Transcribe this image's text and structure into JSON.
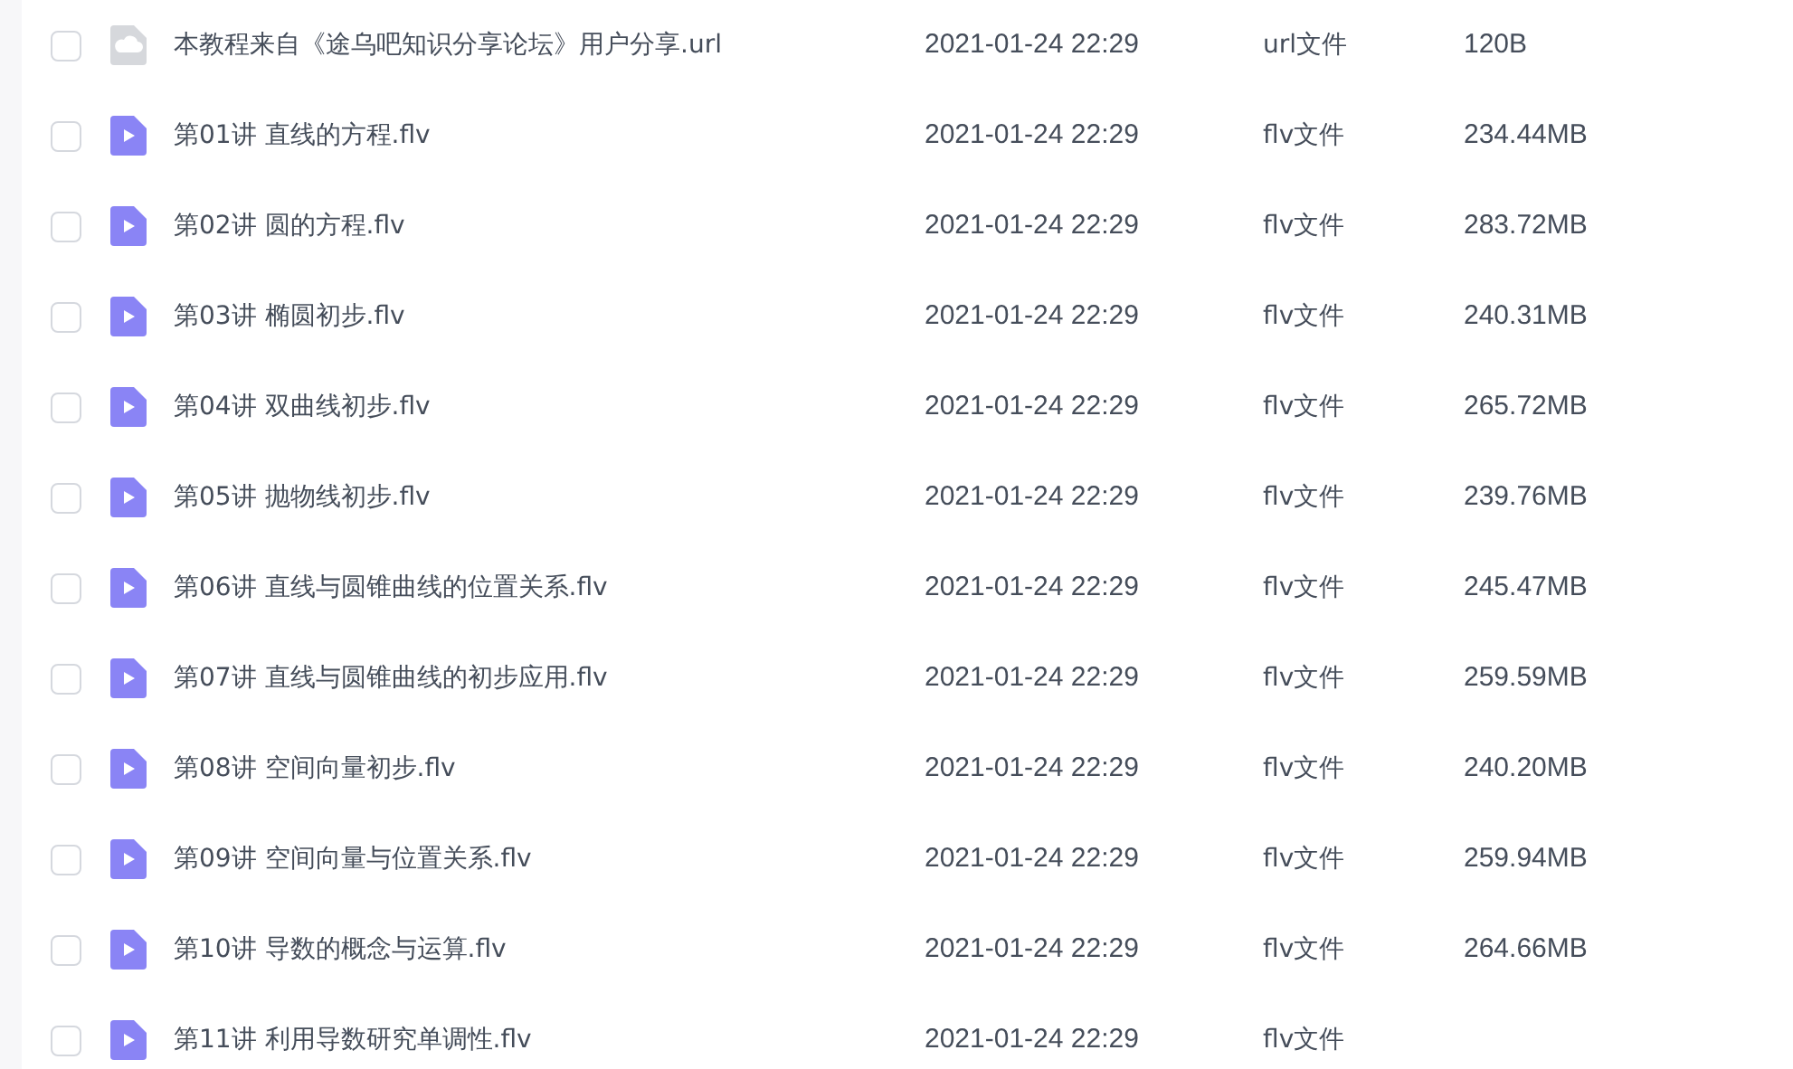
{
  "files": [
    {
      "kind": "link",
      "checked": false,
      "name": "本教程来自《途乌吧知识分享论坛》用户分享.url",
      "time": "2021-01-24 22:29",
      "type": "url文件",
      "size": "120B"
    },
    {
      "kind": "video",
      "checked": false,
      "name": "第01讲 直线的方程.flv",
      "time": "2021-01-24 22:29",
      "type": "flv文件",
      "size": "234.44MB"
    },
    {
      "kind": "video",
      "checked": false,
      "name": "第02讲 圆的方程.flv",
      "time": "2021-01-24 22:29",
      "type": "flv文件",
      "size": "283.72MB"
    },
    {
      "kind": "video",
      "checked": false,
      "name": "第03讲 椭圆初步.flv",
      "time": "2021-01-24 22:29",
      "type": "flv文件",
      "size": "240.31MB"
    },
    {
      "kind": "video",
      "checked": false,
      "name": "第04讲 双曲线初步.flv",
      "time": "2021-01-24 22:29",
      "type": "flv文件",
      "size": "265.72MB"
    },
    {
      "kind": "video",
      "checked": false,
      "name": "第05讲 抛物线初步.flv",
      "time": "2021-01-24 22:29",
      "type": "flv文件",
      "size": "239.76MB"
    },
    {
      "kind": "video",
      "checked": false,
      "name": "第06讲 直线与圆锥曲线的位置关系.flv",
      "time": "2021-01-24 22:29",
      "type": "flv文件",
      "size": "245.47MB"
    },
    {
      "kind": "video",
      "checked": false,
      "name": "第07讲 直线与圆锥曲线的初步应用.flv",
      "time": "2021-01-24 22:29",
      "type": "flv文件",
      "size": "259.59MB"
    },
    {
      "kind": "video",
      "checked": false,
      "name": "第08讲 空间向量初步.flv",
      "time": "2021-01-24 22:29",
      "type": "flv文件",
      "size": "240.20MB"
    },
    {
      "kind": "video",
      "checked": false,
      "name": "第09讲 空间向量与位置关系.flv",
      "time": "2021-01-24 22:29",
      "type": "flv文件",
      "size": "259.94MB"
    },
    {
      "kind": "video",
      "checked": false,
      "name": "第10讲 导数的概念与运算.flv",
      "time": "2021-01-24 22:29",
      "type": "flv文件",
      "size": "264.66MB"
    },
    {
      "kind": "video",
      "checked": false,
      "name": "第11讲 利用导数研究单调性.flv",
      "time": "2021-01-24 22:29",
      "type": "flv文件"
    }
  ]
}
